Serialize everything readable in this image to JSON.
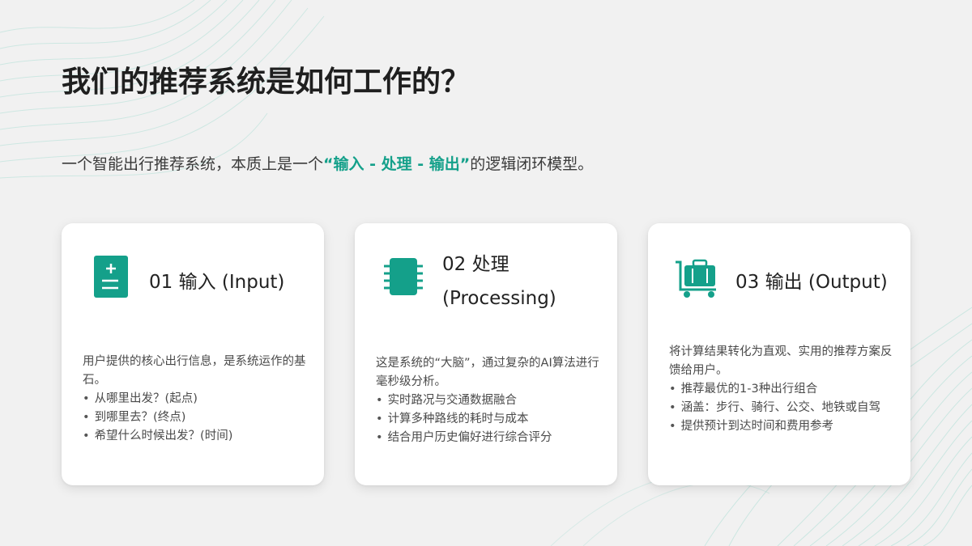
{
  "title": "我们的推荐系统是如何工作的？",
  "subtitle": {
    "before": "一个智能出行推荐系统，本质上是一个",
    "highlight": "“输入 - 处理 - 输出”",
    "after": "的逻辑闭环模型。"
  },
  "accent_color": "#14a08a",
  "cards": [
    {
      "icon": "calculator-icon",
      "title": "01 输入 (Input)",
      "intro": "用户提供的核心出行信息，是系统运作的基石。",
      "bullets": [
        "从哪里出发？(起点)",
        "到哪里去？(终点)",
        "希望什么时候出发？(时间)"
      ]
    },
    {
      "icon": "chip-icon",
      "title": "02 处理 (Processing)",
      "intro": "这是系统的“大脑”，通过复杂的AI算法进行毫秒级分析。",
      "bullets": [
        "实时路况与交通数据融合",
        "计算多种路线的耗时与成本",
        "结合用户历史偏好进行综合评分"
      ]
    },
    {
      "icon": "luggage-cart-icon",
      "title": "03 输出 (Output)",
      "intro": "将计算结果转化为直观、实用的推荐方案反馈给用户。",
      "bullets": [
        "推荐最优的1-3种出行组合",
        "涵盖：步行、骑行、公交、地铁或自驾",
        "提供预计到达时间和费用参考"
      ]
    }
  ]
}
